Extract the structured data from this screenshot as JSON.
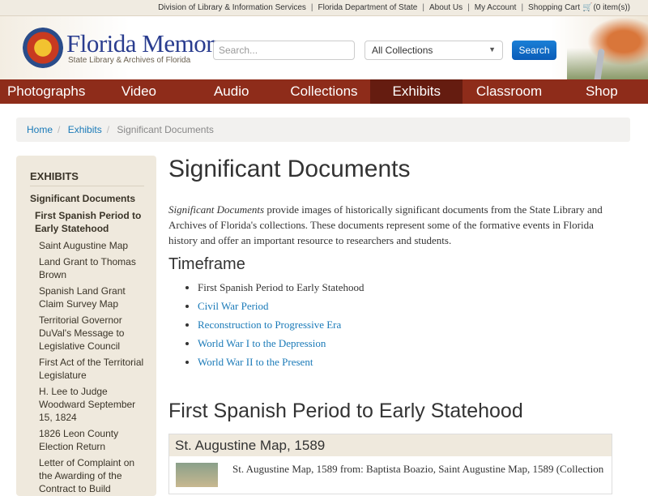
{
  "topbar": {
    "links": [
      "Division of Library & Information Services",
      "Florida Department of State",
      "About Us",
      "My Account",
      "Shopping Cart"
    ],
    "cart_count": "(0 item(s))"
  },
  "header": {
    "logo_title": "Florida Memory",
    "logo_subtitle": "State Library & Archives of Florida",
    "search_placeholder": "Search...",
    "collection_selected": "All Collections",
    "search_button": "Search"
  },
  "nav": [
    "Photographs",
    "Video",
    "Audio",
    "Collections",
    "Exhibits",
    "Classroom",
    "Shop"
  ],
  "breadcrumb": [
    "Home",
    "Exhibits",
    "Significant Documents"
  ],
  "sidebar": {
    "heading": "EXHIBITS",
    "level1": "Significant Documents",
    "level2": "First Spanish Period to Early Statehood",
    "items": [
      "Saint Augustine Map",
      "Land Grant to Thomas Brown",
      "Spanish Land Grant Claim Survey Map",
      "Territorial Governor DuVal's Message to Legislative Council",
      "First Act of the Territorial Legislature",
      "H. Lee to Judge Woodward September 15, 1824",
      "1826 Leon County Election Return",
      "Letter of Complaint on the Awarding of the Contract to Build"
    ]
  },
  "main": {
    "title": "Significant Documents",
    "intro_em": "Significant Documents",
    "intro_rest": " provide images of historically significant documents from the State Library and Archives of Florida's collections. These documents represent some of the formative events in Florida history and offer an important resource to researchers and students.",
    "timeframe_heading": "Timeframe",
    "timeframes": [
      "First Spanish Period to Early Statehood",
      "Civil War Period",
      "Reconstruction to Progressive Era",
      "World War I to the Depression",
      "World War II to the Present"
    ],
    "section_heading": "First Spanish Period to Early Statehood",
    "panel_title": "St. Augustine Map, 1589",
    "panel_text": "St. Augustine Map, 1589 from: Baptista Boazio, Saint Augustine Map, 1589 (Collection"
  }
}
